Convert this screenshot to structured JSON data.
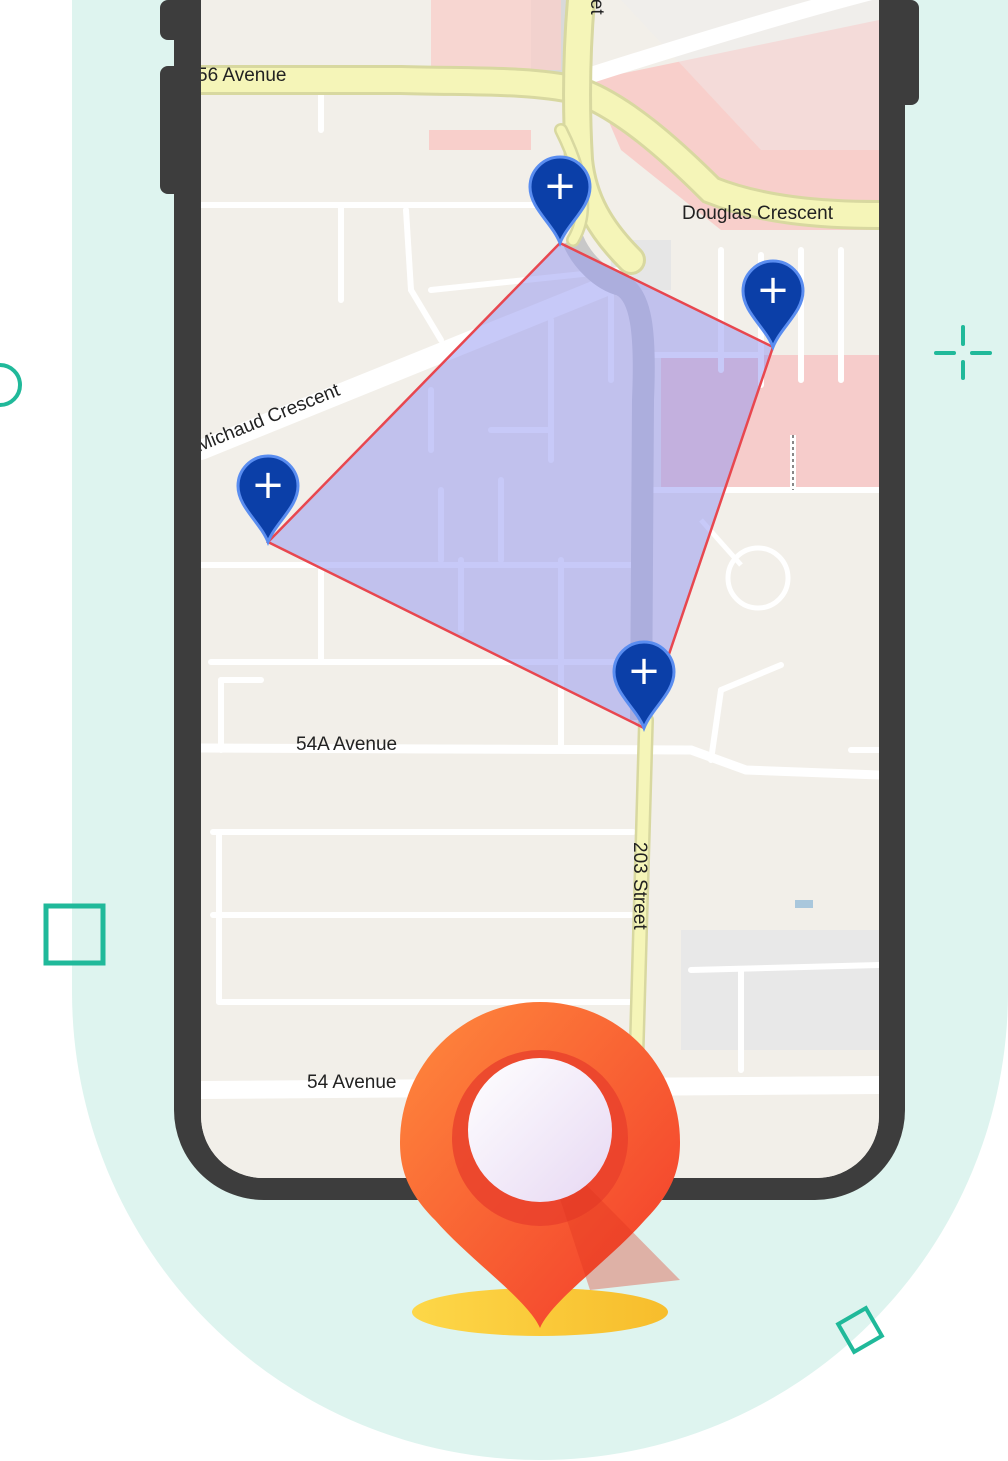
{
  "colors": {
    "background_blob": "#def4ef",
    "accent_teal": "#20b99a",
    "phone_frame": "#3d3d3d",
    "map_land": "#f2efe9",
    "major_road": "#f5f5b8",
    "polygon_fill": "#9fa3f5",
    "polygon_stroke": "#e8474f",
    "marker_blue": "#0b3fa8",
    "pin_orange": "#ff5a2e",
    "pin_shadow_yellow": "#fdd03b"
  },
  "map": {
    "labels": {
      "avenue_56": "56 Avenue",
      "douglas": "Douglas Crescent",
      "michaud": "Michaud Crescent",
      "avenue_54a": "54A Avenue",
      "street_203": "203 Street",
      "avenue_54": "54 Avenue",
      "street_top": "Street"
    },
    "markers": [
      {
        "icon": "plus-icon",
        "label": "+"
      },
      {
        "icon": "plus-icon",
        "label": "+"
      },
      {
        "icon": "plus-icon",
        "label": "+"
      },
      {
        "icon": "plus-icon",
        "label": "+"
      }
    ]
  },
  "hero_icon": "location-pin-icon"
}
